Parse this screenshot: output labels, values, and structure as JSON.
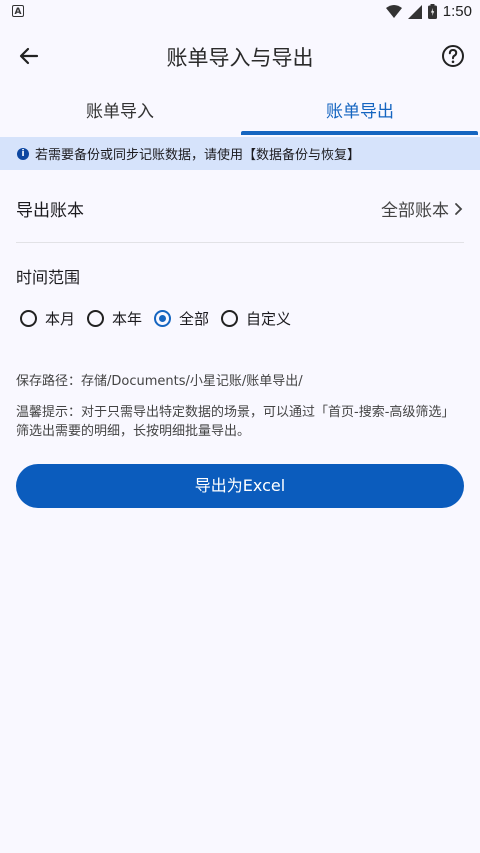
{
  "status_bar": {
    "time": "1:50",
    "notification_letter": "A"
  },
  "app_bar": {
    "title": "账单导入与导出"
  },
  "tabs": [
    {
      "label": "账单导入",
      "selected": false
    },
    {
      "label": "账单导出",
      "selected": true
    }
  ],
  "notice": {
    "text": "若需要备份或同步记账数据，请使用【数据备份与恢复】"
  },
  "export_book": {
    "label": "导出账本",
    "value": "全部账本"
  },
  "time_range": {
    "label": "时间范围",
    "options": [
      {
        "label": "本月",
        "selected": false
      },
      {
        "label": "本年",
        "selected": false
      },
      {
        "label": "全部",
        "selected": true
      },
      {
        "label": "自定义",
        "selected": false
      }
    ]
  },
  "save_path": "保存路径：存储/Documents/小星记账/账单导出/",
  "tip": "温馨提示：对于只需导出特定数据的场景，可以通过「首页-搜索-高级筛选」筛选出需要的明细，长按明细批量导出。",
  "export_button": {
    "label": "导出为Excel"
  },
  "colors": {
    "accent": "#1565c0",
    "button": "#0b5cbd",
    "notice_bg": "#d6e3fb",
    "background": "#f9f8ff"
  }
}
